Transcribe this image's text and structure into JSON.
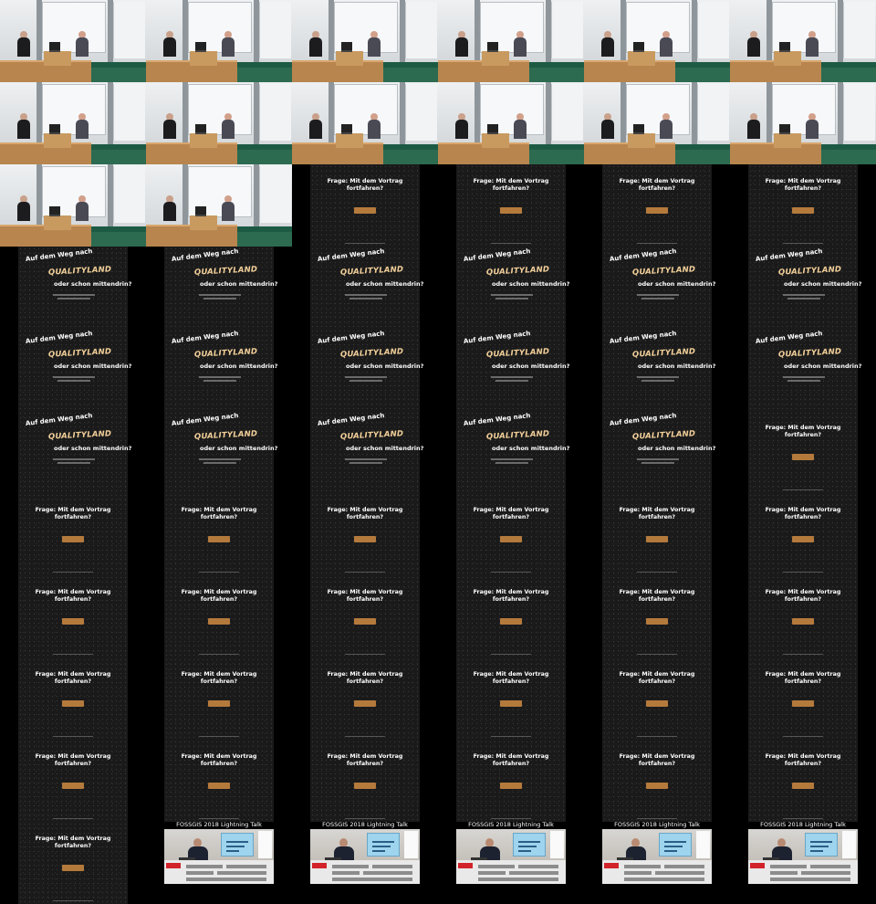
{
  "sheet": {
    "columns": 6,
    "rows": 11,
    "frames": [
      "room",
      "room",
      "room",
      "room",
      "room",
      "room",
      "room",
      "room",
      "room",
      "room",
      "room",
      "room",
      "room",
      "room",
      "frage",
      "frage",
      "frage",
      "frage",
      "quality",
      "quality",
      "quality",
      "quality",
      "quality",
      "quality",
      "quality",
      "quality",
      "quality",
      "quality",
      "quality",
      "quality",
      "quality",
      "quality",
      "quality",
      "quality",
      "quality",
      "frage",
      "frage",
      "frage",
      "frage",
      "frage",
      "frage",
      "frage",
      "frage",
      "frage",
      "frage",
      "frage",
      "frage",
      "frage",
      "frage",
      "frage",
      "frage",
      "frage",
      "frage",
      "frage",
      "frage",
      "frage",
      "frage",
      "frage",
      "frage",
      "frage",
      "frage",
      "talk",
      "talk",
      "talk",
      "talk",
      "talk"
    ]
  },
  "slides": {
    "quality": {
      "line1": "Auf dem Weg nach",
      "line2": "QUALITYLAND",
      "line3": "oder schon mittendrin?"
    },
    "frage": {
      "question": "Frage: Mit dem Vortrag fortfahren?"
    },
    "talk": {
      "title": "FOSSGIS 2018 Lightning Talk"
    }
  },
  "colors": {
    "background": "#000000",
    "accent_gold": "#f2cf99",
    "button_brown": "#b47a3c",
    "board_green": "#2c6b50",
    "desk_wood": "#b8854e"
  }
}
